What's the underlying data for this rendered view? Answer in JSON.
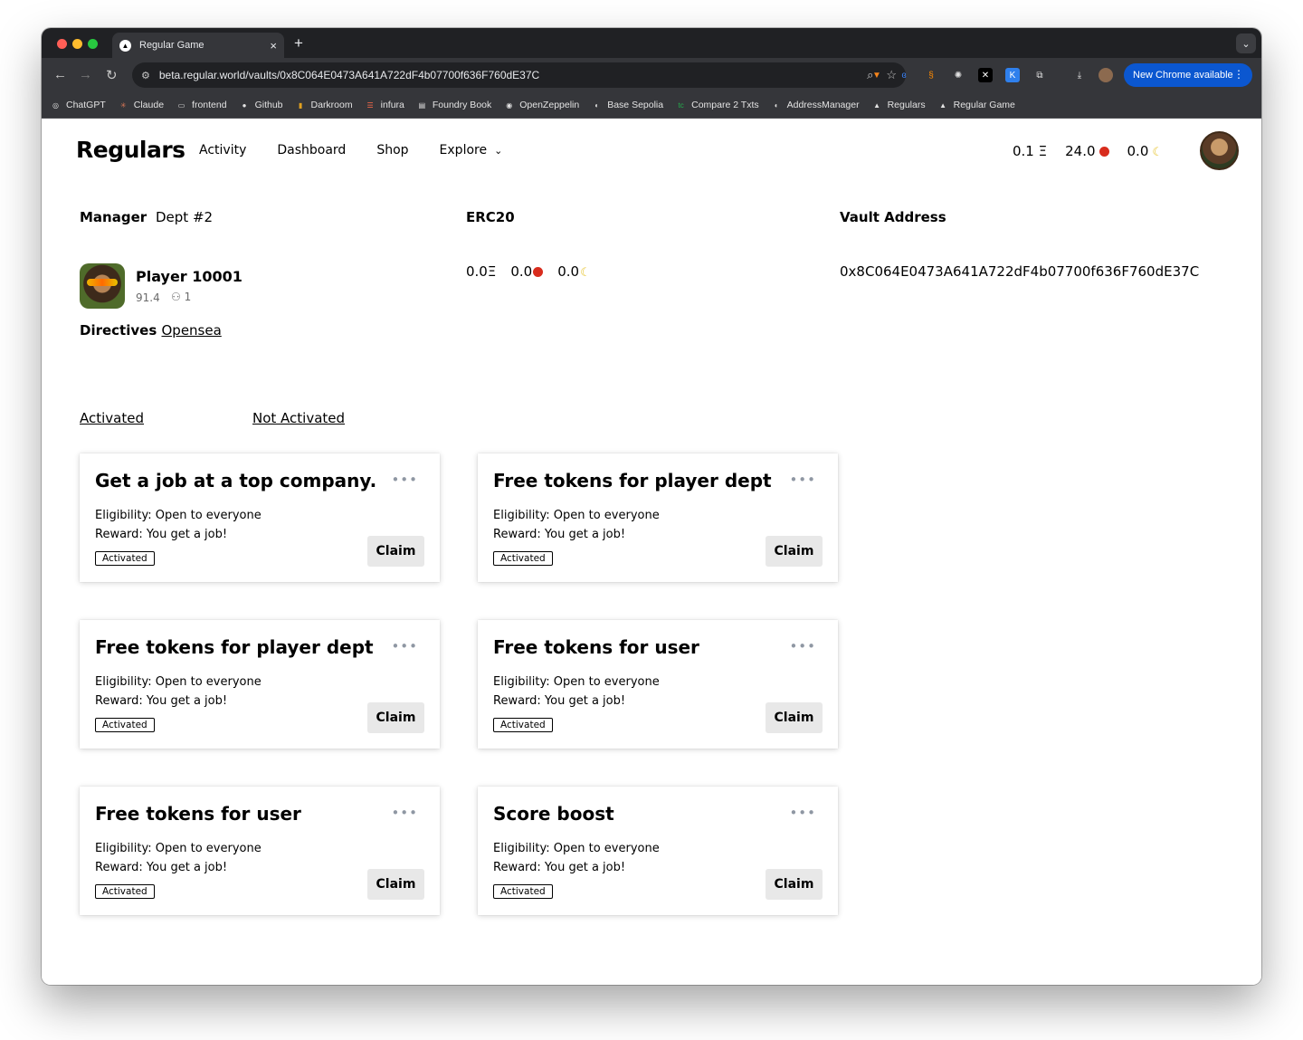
{
  "browser": {
    "tab_title": "Regular Game",
    "tab_favicon": "▲",
    "new_tab_glyph": "+",
    "close_glyph": "×",
    "url": "beta.regular.world/vaults/0x8C064E0473A641A722dF4b07700f636F760dE37C",
    "update_label": "New Chrome available",
    "bookmarks": [
      {
        "label": "ChatGPT",
        "icon": "chatgpt-icon",
        "glyph": "◎",
        "color": "#e3e3e3"
      },
      {
        "label": "Claude",
        "icon": "claude-icon",
        "glyph": "✳",
        "color": "#d97757"
      },
      {
        "label": "frontend",
        "icon": "folder-icon",
        "glyph": "▭",
        "color": "#e3e3e3"
      },
      {
        "label": "Github",
        "icon": "github-icon",
        "glyph": "●",
        "color": "#e3e3e3"
      },
      {
        "label": "Darkroom",
        "icon": "darkroom-icon",
        "glyph": "▮",
        "color": "#e0a020"
      },
      {
        "label": "infura",
        "icon": "infura-icon",
        "glyph": "☰",
        "color": "#ff6b4a"
      },
      {
        "label": "Foundry Book",
        "icon": "book-icon",
        "glyph": "▤",
        "color": "#e3e3e3"
      },
      {
        "label": "OpenZeppelin",
        "icon": "openzeppelin-icon",
        "glyph": "◉",
        "color": "#e3e3e3"
      },
      {
        "label": "Base Sepolia",
        "icon": "base-icon",
        "glyph": "◐",
        "color": "#e3e3e3"
      },
      {
        "label": "Compare 2 Txts",
        "icon": "compare-icon",
        "glyph": "tc",
        "color": "#22b14c"
      },
      {
        "label": "AddressManager",
        "icon": "address-manager-icon",
        "glyph": "◐",
        "color": "#e3e3e3"
      },
      {
        "label": "Regulars",
        "icon": "regulars-icon",
        "glyph": "▲",
        "color": "#e3e3e3"
      },
      {
        "label": "Regular Game",
        "icon": "regular-game-icon",
        "glyph": "▲",
        "color": "#e3e3e3"
      }
    ]
  },
  "header": {
    "brand": "Regulars",
    "nav": [
      "Activity",
      "Dashboard",
      "Shop",
      "Explore"
    ],
    "balances": {
      "eth": "0.1 Ξ",
      "apple": "24.0",
      "banana": "0.0"
    }
  },
  "manager": {
    "label": "Manager",
    "dept": "Dept #2",
    "player_name": "Player 10001",
    "score": "91.4",
    "members": "1"
  },
  "erc20": {
    "label": "ERC20",
    "eth": "0.0Ξ",
    "apple": "0.0",
    "banana": "0.0"
  },
  "vault": {
    "label": "Vault Address",
    "address": "0x8C064E0473A641A722dF4b07700f636F760dE37C"
  },
  "directives": {
    "label": "Directives",
    "link": "Opensea",
    "filters": [
      "Activated",
      "Not Activated"
    ]
  },
  "cards": [
    {
      "title": "Get a job at a top company.",
      "eligibility": "Eligibility: Open to everyone",
      "reward": "Reward: You get a job!",
      "status": "Activated",
      "button": "Claim"
    },
    {
      "title": "Free tokens for player dept",
      "eligibility": "Eligibility: Open to everyone",
      "reward": "Reward: You get a job!",
      "status": "Activated",
      "button": "Claim"
    },
    {
      "title": "Free tokens for player dept",
      "eligibility": "Eligibility: Open to everyone",
      "reward": "Reward: You get a job!",
      "status": "Activated",
      "button": "Claim"
    },
    {
      "title": "Free tokens for user",
      "eligibility": "Eligibility: Open to everyone",
      "reward": "Reward: You get a job!",
      "status": "Activated",
      "button": "Claim"
    },
    {
      "title": "Free tokens for user",
      "eligibility": "Eligibility: Open to everyone",
      "reward": "Reward: You get a job!",
      "status": "Activated",
      "button": "Claim"
    },
    {
      "title": "Score boost",
      "eligibility": "Eligibility: Open to everyone",
      "reward": "Reward: You get a job!",
      "status": "Activated",
      "button": "Claim"
    }
  ]
}
